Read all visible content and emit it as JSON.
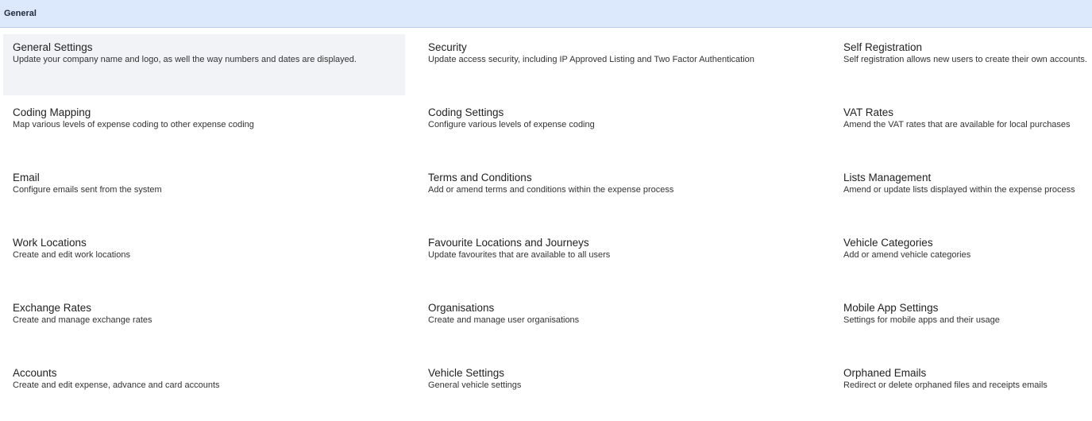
{
  "section": {
    "title": "General"
  },
  "colors": {
    "header_bg": "#dce8fb",
    "active_tile_bg": "#f1f3f6"
  },
  "tiles": [
    {
      "title": "General Settings",
      "description": "Update your company name and logo, as well the way numbers and dates are displayed."
    },
    {
      "title": "Security",
      "description": "Update access security, including IP Approved Listing and Two Factor Authentication"
    },
    {
      "title": "Self Registration",
      "description": "Self registration allows new users to create their own accounts."
    },
    {
      "title": "Coding Mapping",
      "description": "Map various levels of expense coding to other expense coding"
    },
    {
      "title": "Coding Settings",
      "description": "Configure various levels of expense coding"
    },
    {
      "title": "VAT Rates",
      "description": "Amend the VAT rates that are available for local purchases"
    },
    {
      "title": "Email",
      "description": "Configure emails sent from the system"
    },
    {
      "title": "Terms and Conditions",
      "description": "Add or amend terms and conditions within the expense process"
    },
    {
      "title": "Lists Management",
      "description": "Amend or update lists displayed within the expense process"
    },
    {
      "title": "Work Locations",
      "description": "Create and edit work locations"
    },
    {
      "title": "Favourite Locations and Journeys",
      "description": "Update favourites that are available to all users"
    },
    {
      "title": "Vehicle Categories",
      "description": "Add or amend vehicle categories"
    },
    {
      "title": "Exchange Rates",
      "description": "Create and manage exchange rates"
    },
    {
      "title": "Organisations",
      "description": "Create and manage user organisations"
    },
    {
      "title": "Mobile App Settings",
      "description": "Settings for mobile apps and their usage"
    },
    {
      "title": "Accounts",
      "description": "Create and edit expense, advance and card accounts"
    },
    {
      "title": "Vehicle Settings",
      "description": "General vehicle settings"
    },
    {
      "title": "Orphaned Emails",
      "description": "Redirect or delete orphaned files and receipts emails"
    }
  ]
}
